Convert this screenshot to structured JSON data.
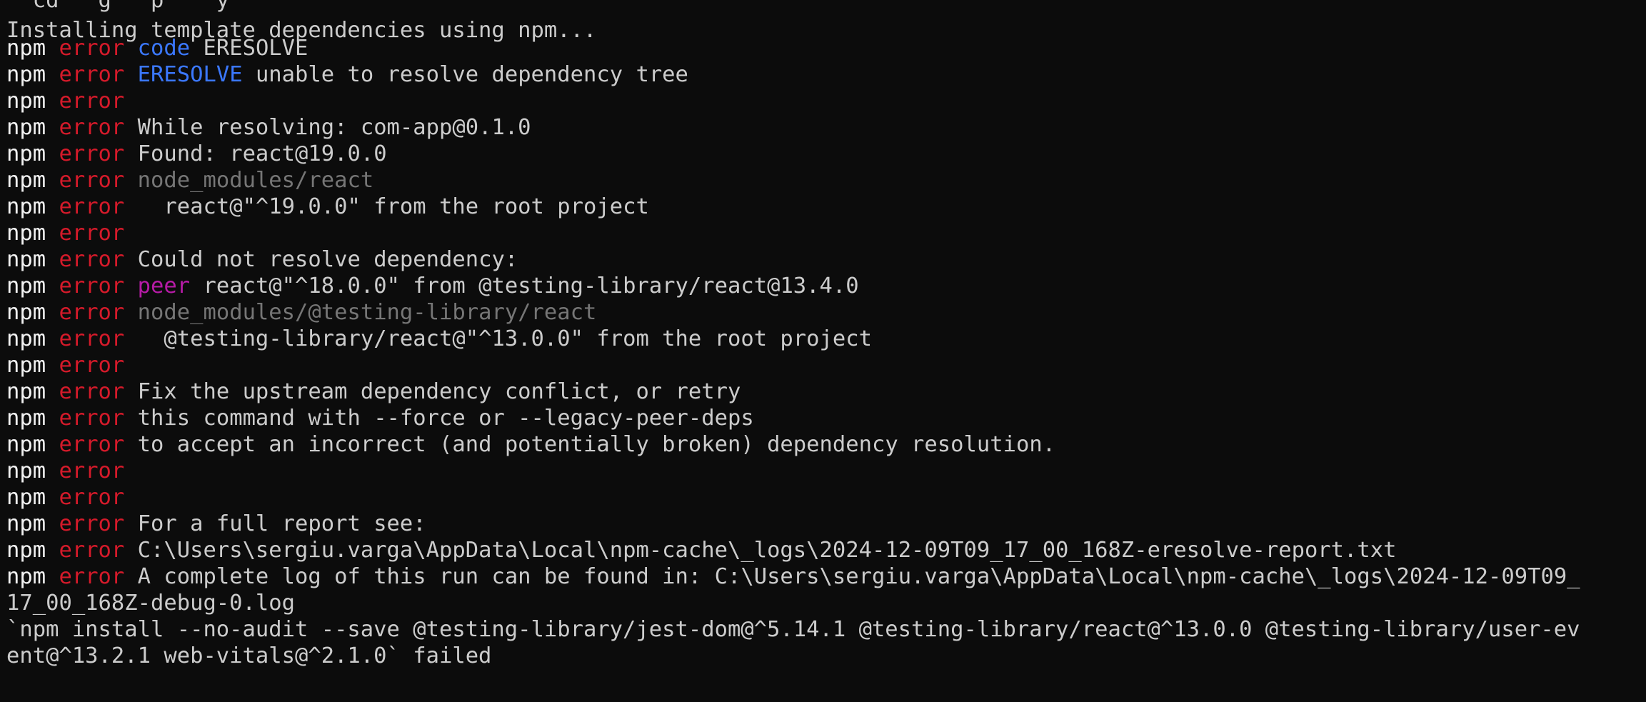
{
  "terminal": {
    "clipped_top": "  cd   g   p    y",
    "installing": "Installing template dependencies using npm...",
    "prefix": "npm",
    "error": "error",
    "lines": {
      "l1_kw": "code",
      "l1_msg": " ERESOLVE",
      "l2_kw": "ERESOLVE",
      "l2_msg": " unable to resolve dependency tree",
      "l4_msg": "While resolving: com-app@0.1.0",
      "l5_msg": "Found: react@19.0.0",
      "l6_dim": "node_modules/react",
      "l7_msg": "  react@\"^19.0.0\" from the root project",
      "l9_msg": "Could not resolve dependency:",
      "l10_kw": "peer",
      "l10_msg": " react@\"^18.0.0\" from @testing-library/react@13.4.0",
      "l11_dim": "node_modules/@testing-library/react",
      "l12_msg": "  @testing-library/react@\"^13.0.0\" from the root project",
      "l14_msg": "Fix the upstream dependency conflict, or retry",
      "l15_msg": "this command with --force or --legacy-peer-deps",
      "l16_msg": "to accept an incorrect (and potentially broken) dependency resolution.",
      "l19_msg": "For a full report see:",
      "l20_msg": "C:\\Users\\sergiu.varga\\AppData\\Local\\npm-cache\\_logs\\2024-12-09T09_17_00_168Z-eresolve-report.txt",
      "l21_msg": "A complete log of this run can be found in: C:\\Users\\sergiu.varga\\AppData\\Local\\npm-cache\\_logs\\2024-12-09T09_",
      "l21_wrap": "17_00_168Z-debug-0.log",
      "failed_1": "`npm install --no-audit --save @testing-library/jest-dom@^5.14.1 @testing-library/react@^13.0.0 @testing-library/user-ev",
      "failed_2": "ent@^13.2.1 web-vitals@^2.1.0` failed"
    }
  },
  "colors": {
    "background": "#0c0c0c",
    "text": "#cccccc",
    "npm": "#f2f2f2",
    "error": "#d51a2a",
    "keyword_blue": "#3b78ff",
    "peer_magenta": "#b61ba6",
    "path_dim": "#767676"
  }
}
